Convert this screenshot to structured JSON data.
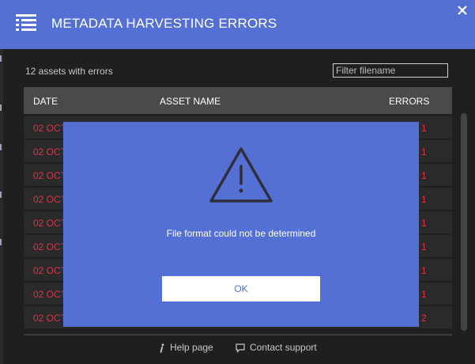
{
  "header": {
    "title": "METADATA HARVESTING ERRORS",
    "menu_icon": "list-menu-icon",
    "close_icon": "close-icon",
    "color": "#5570d4"
  },
  "toolbar": {
    "asset_count": "12 assets with errors",
    "filter_placeholder": "Filter filename"
  },
  "table": {
    "columns": {
      "date": "DATE",
      "asset_name": "ASSET NAME",
      "errors": "ERRORS"
    },
    "rows": [
      {
        "date": "02 OCT",
        "errors": "1"
      },
      {
        "date": "02 OCT",
        "errors": "1"
      },
      {
        "date": "02 OCT",
        "errors": "1"
      },
      {
        "date": "02 OCT",
        "errors": "1"
      },
      {
        "date": "02 OCT",
        "errors": "1"
      },
      {
        "date": "02 OCT",
        "errors": "1"
      },
      {
        "date": "02 OCT",
        "errors": "1"
      },
      {
        "date": "02 OCT",
        "errors": "1"
      },
      {
        "date": "02 OCT",
        "errors": "2"
      }
    ],
    "error_color": "#e0334a"
  },
  "dialog": {
    "icon": "warning-icon",
    "message": "File format could not be determined",
    "ok_label": "OK"
  },
  "footer": {
    "help_label": "Help page",
    "help_icon": "info-icon",
    "support_label": "Contact support",
    "support_icon": "chat-bubble-icon"
  }
}
